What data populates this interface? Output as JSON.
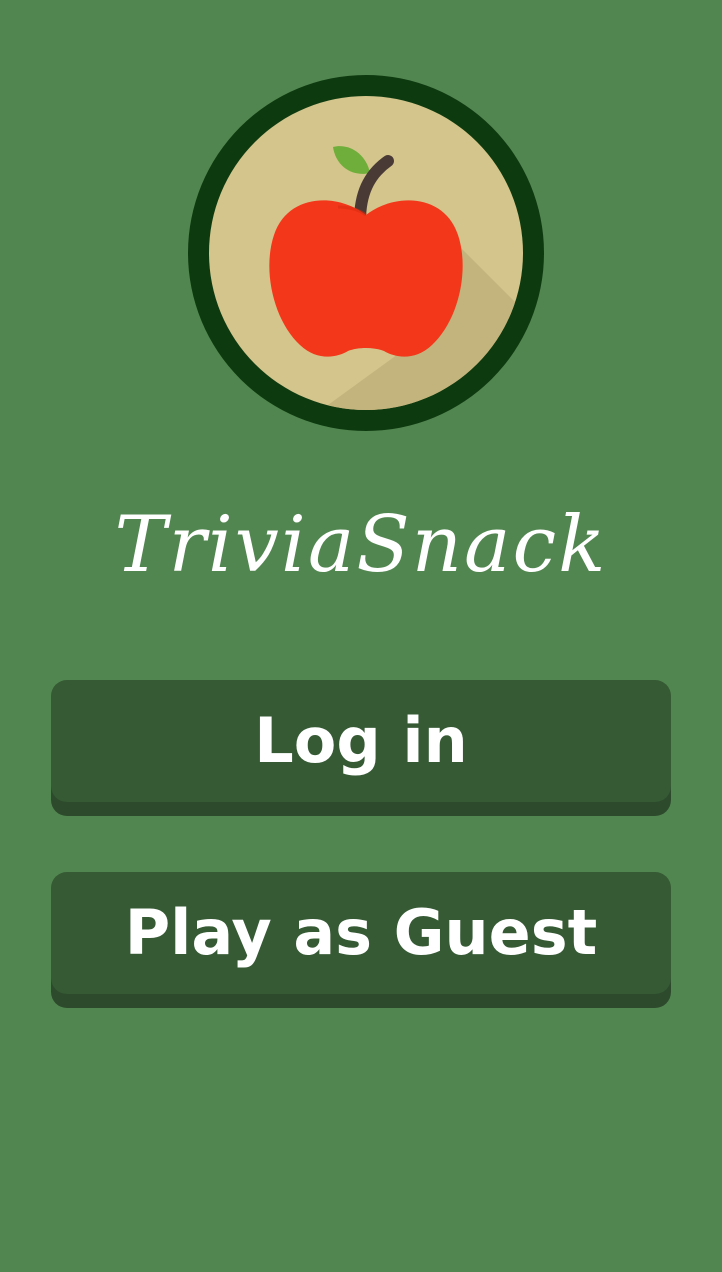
{
  "app": {
    "title": "TriviaSnack"
  },
  "logo": {
    "icon": "apple-icon",
    "ring_color": "#0e3a10",
    "background_color": "#d3c58c",
    "apple_color": "#f2371a",
    "leaf_color": "#6fae3a",
    "stem_color": "#4a3a35"
  },
  "buttons": {
    "login_label": "Log in",
    "guest_label": "Play as Guest"
  },
  "colors": {
    "background": "#528650",
    "button": "#355a34",
    "button_shadow": "#2d4b2c",
    "text": "#ffffff"
  }
}
